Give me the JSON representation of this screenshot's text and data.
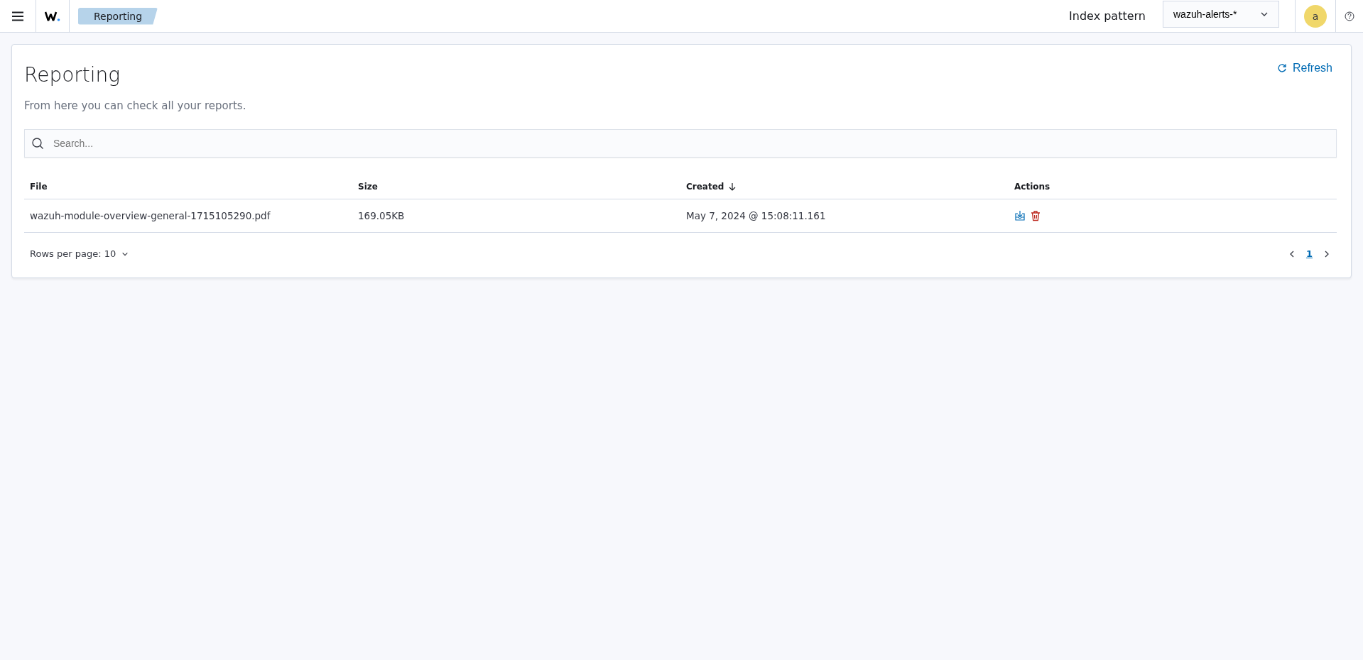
{
  "header": {
    "breadcrumb": "Reporting",
    "index_pattern_label": "Index pattern",
    "index_pattern_value": "wazuh-alerts-*",
    "avatar": "a"
  },
  "page": {
    "title": "Reporting",
    "description": "From here you can check all your reports.",
    "refresh_label": "Refresh",
    "search": {
      "placeholder": "Search..."
    }
  },
  "table": {
    "columns": [
      {
        "label": "File",
        "sorted": false
      },
      {
        "label": "Size",
        "sorted": false
      },
      {
        "label": "Created",
        "sorted": true
      },
      {
        "label": "Actions",
        "sorted": false
      }
    ],
    "rows": [
      {
        "file": "wazuh-module-overview-general-1715105290.pdf",
        "size": "169.05KB",
        "created": "May 7, 2024 @ 15:08:11.161"
      }
    ]
  },
  "pagination": {
    "rows_per_page": "Rows per page: 10",
    "pages": [
      {
        "label": "1",
        "selected": true
      }
    ]
  }
}
